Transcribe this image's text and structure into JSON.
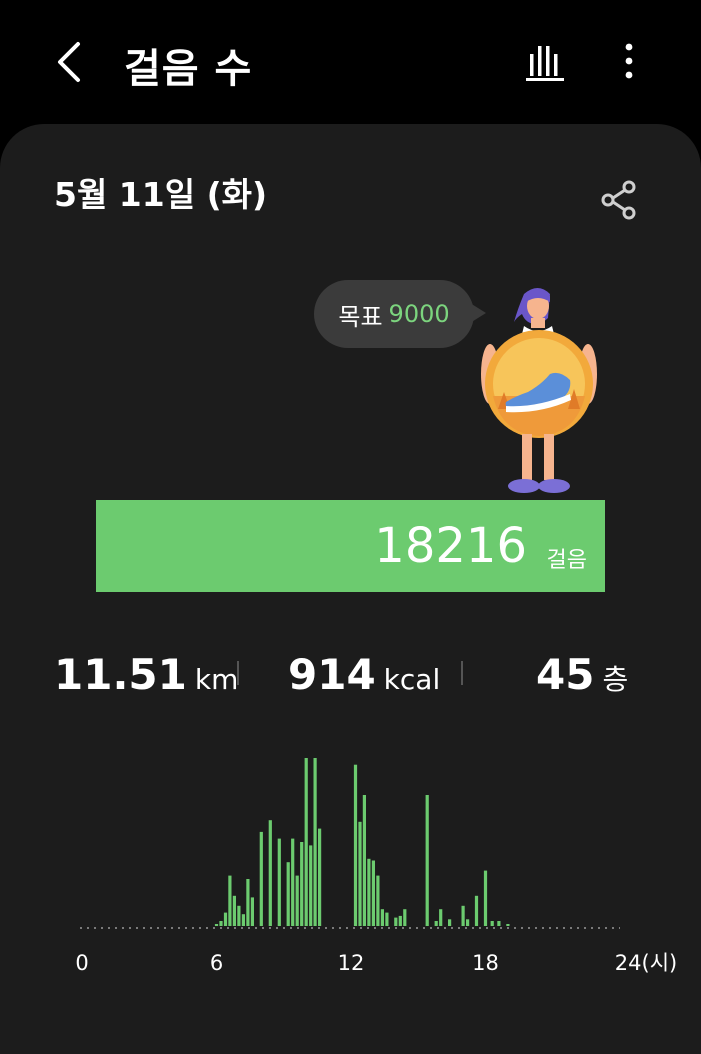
{
  "header": {
    "title": "걸음 수",
    "back_icon": "chevron-left-icon",
    "chart_icon": "bar-chart-icon",
    "more_icon": "more-vert-icon"
  },
  "card": {
    "date": "5월 11일 (화)",
    "share_icon": "share-icon",
    "goal_label": "목표",
    "goal_value": "9000",
    "steps_value": "18216",
    "steps_unit": "걸음",
    "progress_fraction": 1.0
  },
  "stats": [
    {
      "value": "11.51",
      "unit": "km"
    },
    {
      "value": "914",
      "unit": "kcal"
    },
    {
      "value": "45",
      "unit": "층"
    }
  ],
  "colors": {
    "accent_green": "#6ccb6f",
    "card_bg": "#1c1c1c",
    "background": "#000000"
  },
  "chart_data": {
    "type": "bar",
    "x_unit": "(시)",
    "x_tick_labels": [
      "0",
      "6",
      "12",
      "18",
      "24(시)"
    ],
    "xlim": [
      0,
      24
    ],
    "x": [
      6.0,
      6.2,
      6.4,
      6.6,
      6.8,
      7.0,
      7.2,
      7.4,
      7.6,
      8.0,
      8.4,
      8.8,
      9.2,
      9.4,
      9.6,
      9.8,
      10.0,
      10.2,
      10.4,
      10.6,
      12.2,
      12.4,
      12.6,
      12.8,
      13.0,
      13.2,
      13.4,
      13.6,
      14.0,
      14.2,
      14.4,
      15.4,
      15.8,
      16.0,
      16.4,
      17.0,
      17.2,
      17.6,
      18.0,
      18.3,
      18.6,
      19.0
    ],
    "values": [
      1,
      3,
      8,
      30,
      18,
      12,
      7,
      28,
      17,
      56,
      63,
      52,
      38,
      52,
      30,
      50,
      100,
      48,
      100,
      58,
      96,
      62,
      78,
      40,
      39,
      30,
      10,
      8,
      5,
      6,
      10,
      78,
      3,
      10,
      4,
      12,
      4,
      18,
      33,
      3,
      3,
      1
    ]
  }
}
